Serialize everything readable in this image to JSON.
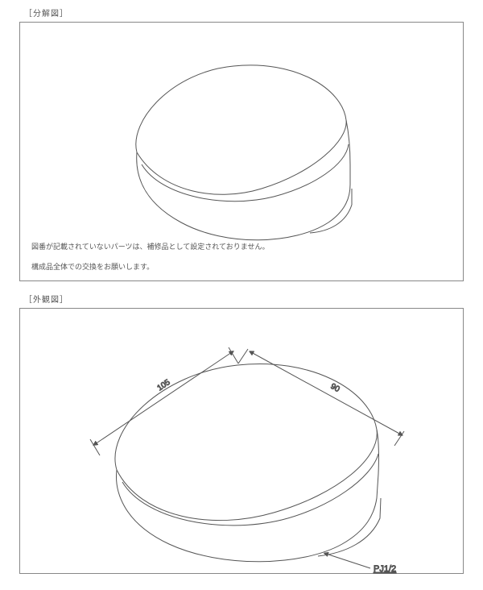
{
  "sections": {
    "exploded": {
      "label": "［分解図］",
      "note_line1": "図番が記載されていないパーツは、補修品として設定されておりません。",
      "note_line2": "構成品全体での交換をお願いします。"
    },
    "external": {
      "label": "［外観図］",
      "dimensions": {
        "left": "105",
        "right": "90"
      },
      "callout": "PJ1/2"
    }
  }
}
